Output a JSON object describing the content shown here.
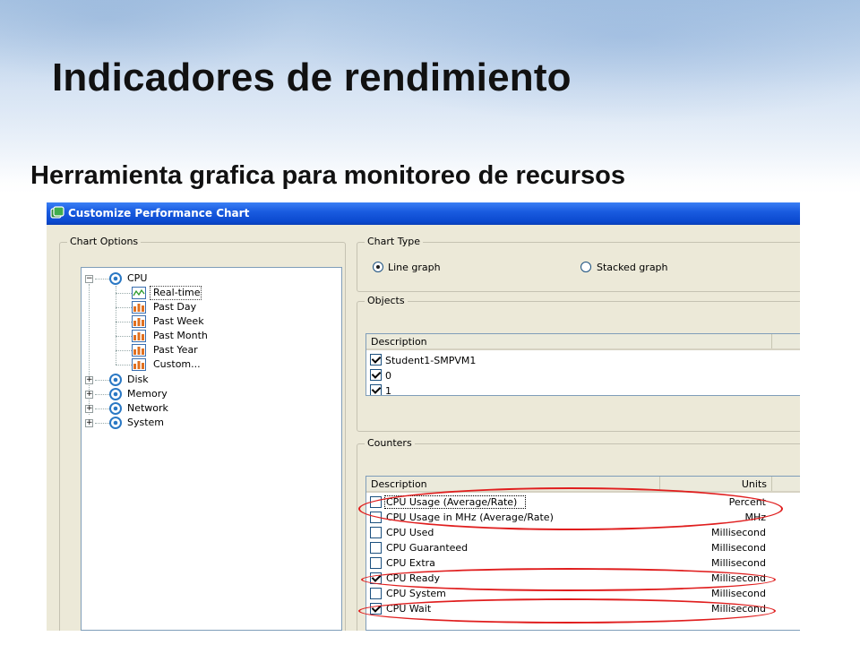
{
  "slide": {
    "title": "Indicadores de rendimiento",
    "subtitle": "Herramienta grafica para monitoreo de recursos"
  },
  "dialog": {
    "title": "Customize Performance Chart",
    "chart_options": {
      "label": "Chart Options",
      "tree": {
        "root": "CPU",
        "cpu_items": [
          "Real-time",
          "Past Day",
          "Past Week",
          "Past Month",
          "Past Year",
          "Custom..."
        ],
        "selected": "Real-time",
        "other_roots": [
          "Disk",
          "Memory",
          "Network",
          "System"
        ]
      }
    },
    "chart_type": {
      "label": "Chart Type",
      "options": [
        "Line graph",
        "Stacked graph"
      ],
      "selected": "Line graph"
    },
    "objects": {
      "label": "Objects",
      "column_header": "Description",
      "rows": [
        {
          "description": "Student1-SMPVM1",
          "checked": true
        },
        {
          "description": "0",
          "checked": true
        },
        {
          "description": "1",
          "checked": true
        }
      ]
    },
    "counters": {
      "label": "Counters",
      "headers": {
        "description": "Description",
        "units": "Units"
      },
      "rows": [
        {
          "description": "CPU Usage (Average/Rate)",
          "units": "Percent",
          "checked": false
        },
        {
          "description": "CPU Usage in MHz (Average/Rate)",
          "units": "MHz",
          "checked": false
        },
        {
          "description": "CPU Used",
          "units": "Millisecond",
          "checked": false
        },
        {
          "description": "CPU Guaranteed",
          "units": "Millisecond",
          "checked": false
        },
        {
          "description": "CPU Extra",
          "units": "Millisecond",
          "checked": false
        },
        {
          "description": "CPU Ready",
          "units": "Millisecond",
          "checked": true
        },
        {
          "description": "CPU System",
          "units": "Millisecond",
          "checked": false
        },
        {
          "description": "CPU Wait",
          "units": "Millisecond",
          "checked": true
        }
      ]
    }
  },
  "colors": {
    "titlebar": "#0b49cf",
    "highlight_annotation": "#e01e1e",
    "dialog_face": "#ece9d8"
  }
}
